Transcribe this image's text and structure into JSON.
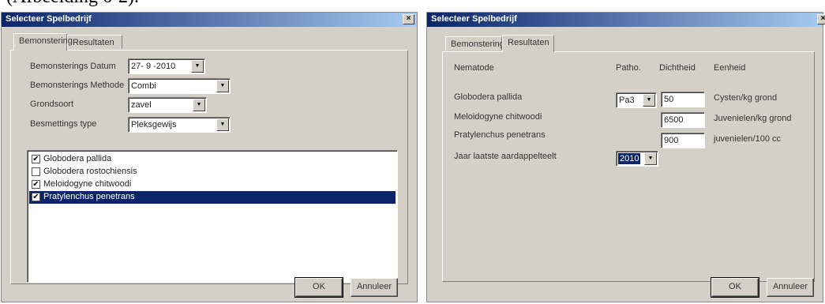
{
  "caption": "(Afbeelding 6-2).",
  "window1": {
    "title": "Selecteer Spelbedrijf",
    "close": "×",
    "tabs": [
      "Bemonstering",
      "Resultaten"
    ],
    "form": {
      "datum_label": "Bemonsterings Datum",
      "datum_value": "27- 9 -2010",
      "methode_label": "Bemonsterings Methode",
      "methode_value": "Combi",
      "grondsoort_label": "Grondsoort",
      "grondsoort_value": "zavel",
      "besmetting_label": "Besmettings type",
      "besmetting_value": "Pleksgewijs"
    },
    "nematodes": [
      {
        "name": "Globodera pallida",
        "checked": true
      },
      {
        "name": "Globodera rostochiensis",
        "checked": false
      },
      {
        "name": "Meloidogyne chitwoodi",
        "checked": true
      },
      {
        "name": "Pratylenchus penetrans",
        "checked": true
      }
    ],
    "ok_label": "OK",
    "cancel_label": "Annuleer"
  },
  "window2": {
    "title": "Selecteer Spelbedrijf",
    "close": "×",
    "tabs": [
      "Bemonstering",
      "Resultaten"
    ],
    "headers": {
      "nematode": "Nematode",
      "patho": "Patho.",
      "dichtheid": "Dichtheid",
      "eenheid": "Eenheid"
    },
    "rows": [
      {
        "name": "Globodera pallida",
        "patho": "Pa3",
        "dichtheid": "50",
        "eenheid": "Cysten/kg grond"
      },
      {
        "name": "Meloidogyne chitwoodi",
        "dichtheid": "6500",
        "eenheid": "Juvenielen/kg grond"
      },
      {
        "name": "Pratylenchus penetrans",
        "dichtheid": "900",
        "eenheid": "juvenielen/100 cc"
      }
    ],
    "jaar_label": "Jaar laatste aardappelteelt",
    "jaar_value": "2010",
    "ok_label": "OK",
    "cancel_label": "Annuleer"
  }
}
